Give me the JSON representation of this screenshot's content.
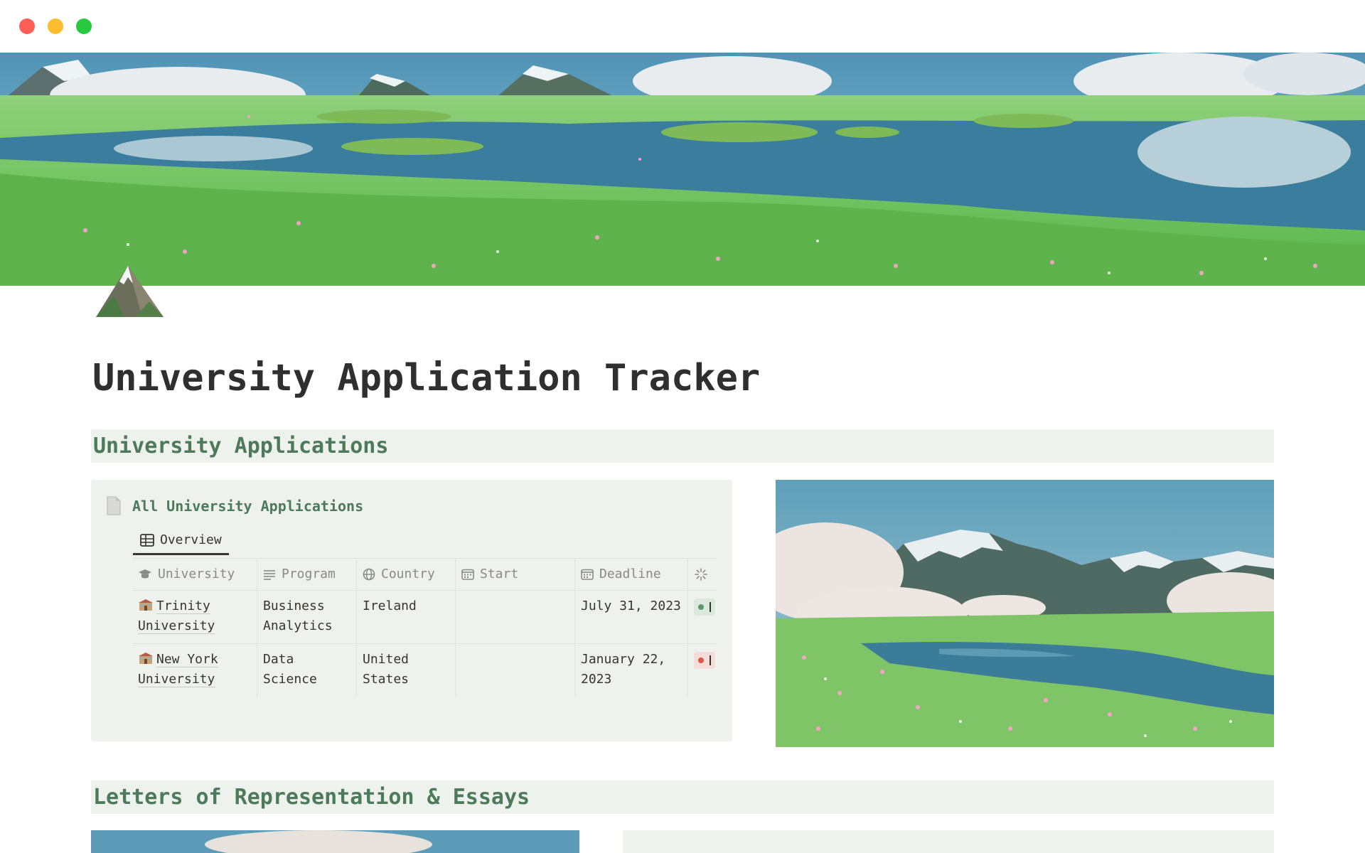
{
  "page": {
    "title": "University Application Tracker",
    "icon": "mountain-icon"
  },
  "sections": {
    "applications": "University Applications",
    "letters": "Letters of Representation & Essays"
  },
  "database": {
    "title": "All University Applications",
    "view_tab": "Overview",
    "columns": [
      {
        "label": "University",
        "icon": "graduation-cap-icon"
      },
      {
        "label": "Program",
        "icon": "text-lines-icon"
      },
      {
        "label": "Country",
        "icon": "globe-icon"
      },
      {
        "label": "Start",
        "icon": "calendar-icon"
      },
      {
        "label": "Deadline",
        "icon": "calendar-icon"
      },
      {
        "label": "",
        "icon": "status-loader-icon"
      }
    ],
    "rows": [
      {
        "university": "Trinity University",
        "program": "Business Analytics",
        "country": "Ireland",
        "start": "",
        "deadline": "July 31, 2023",
        "status_color": "#5c9a6a"
      },
      {
        "university": "New York University",
        "program": "Data Science",
        "country": "United States",
        "start": "",
        "deadline": "January 22, 2023",
        "status_color": "#d6584b"
      }
    ]
  },
  "colors": {
    "accent_green": "#4c7a5a",
    "section_bg": "#eef2ec",
    "card_bg": "#eef1ec",
    "title_text": "#2f2f2f"
  }
}
